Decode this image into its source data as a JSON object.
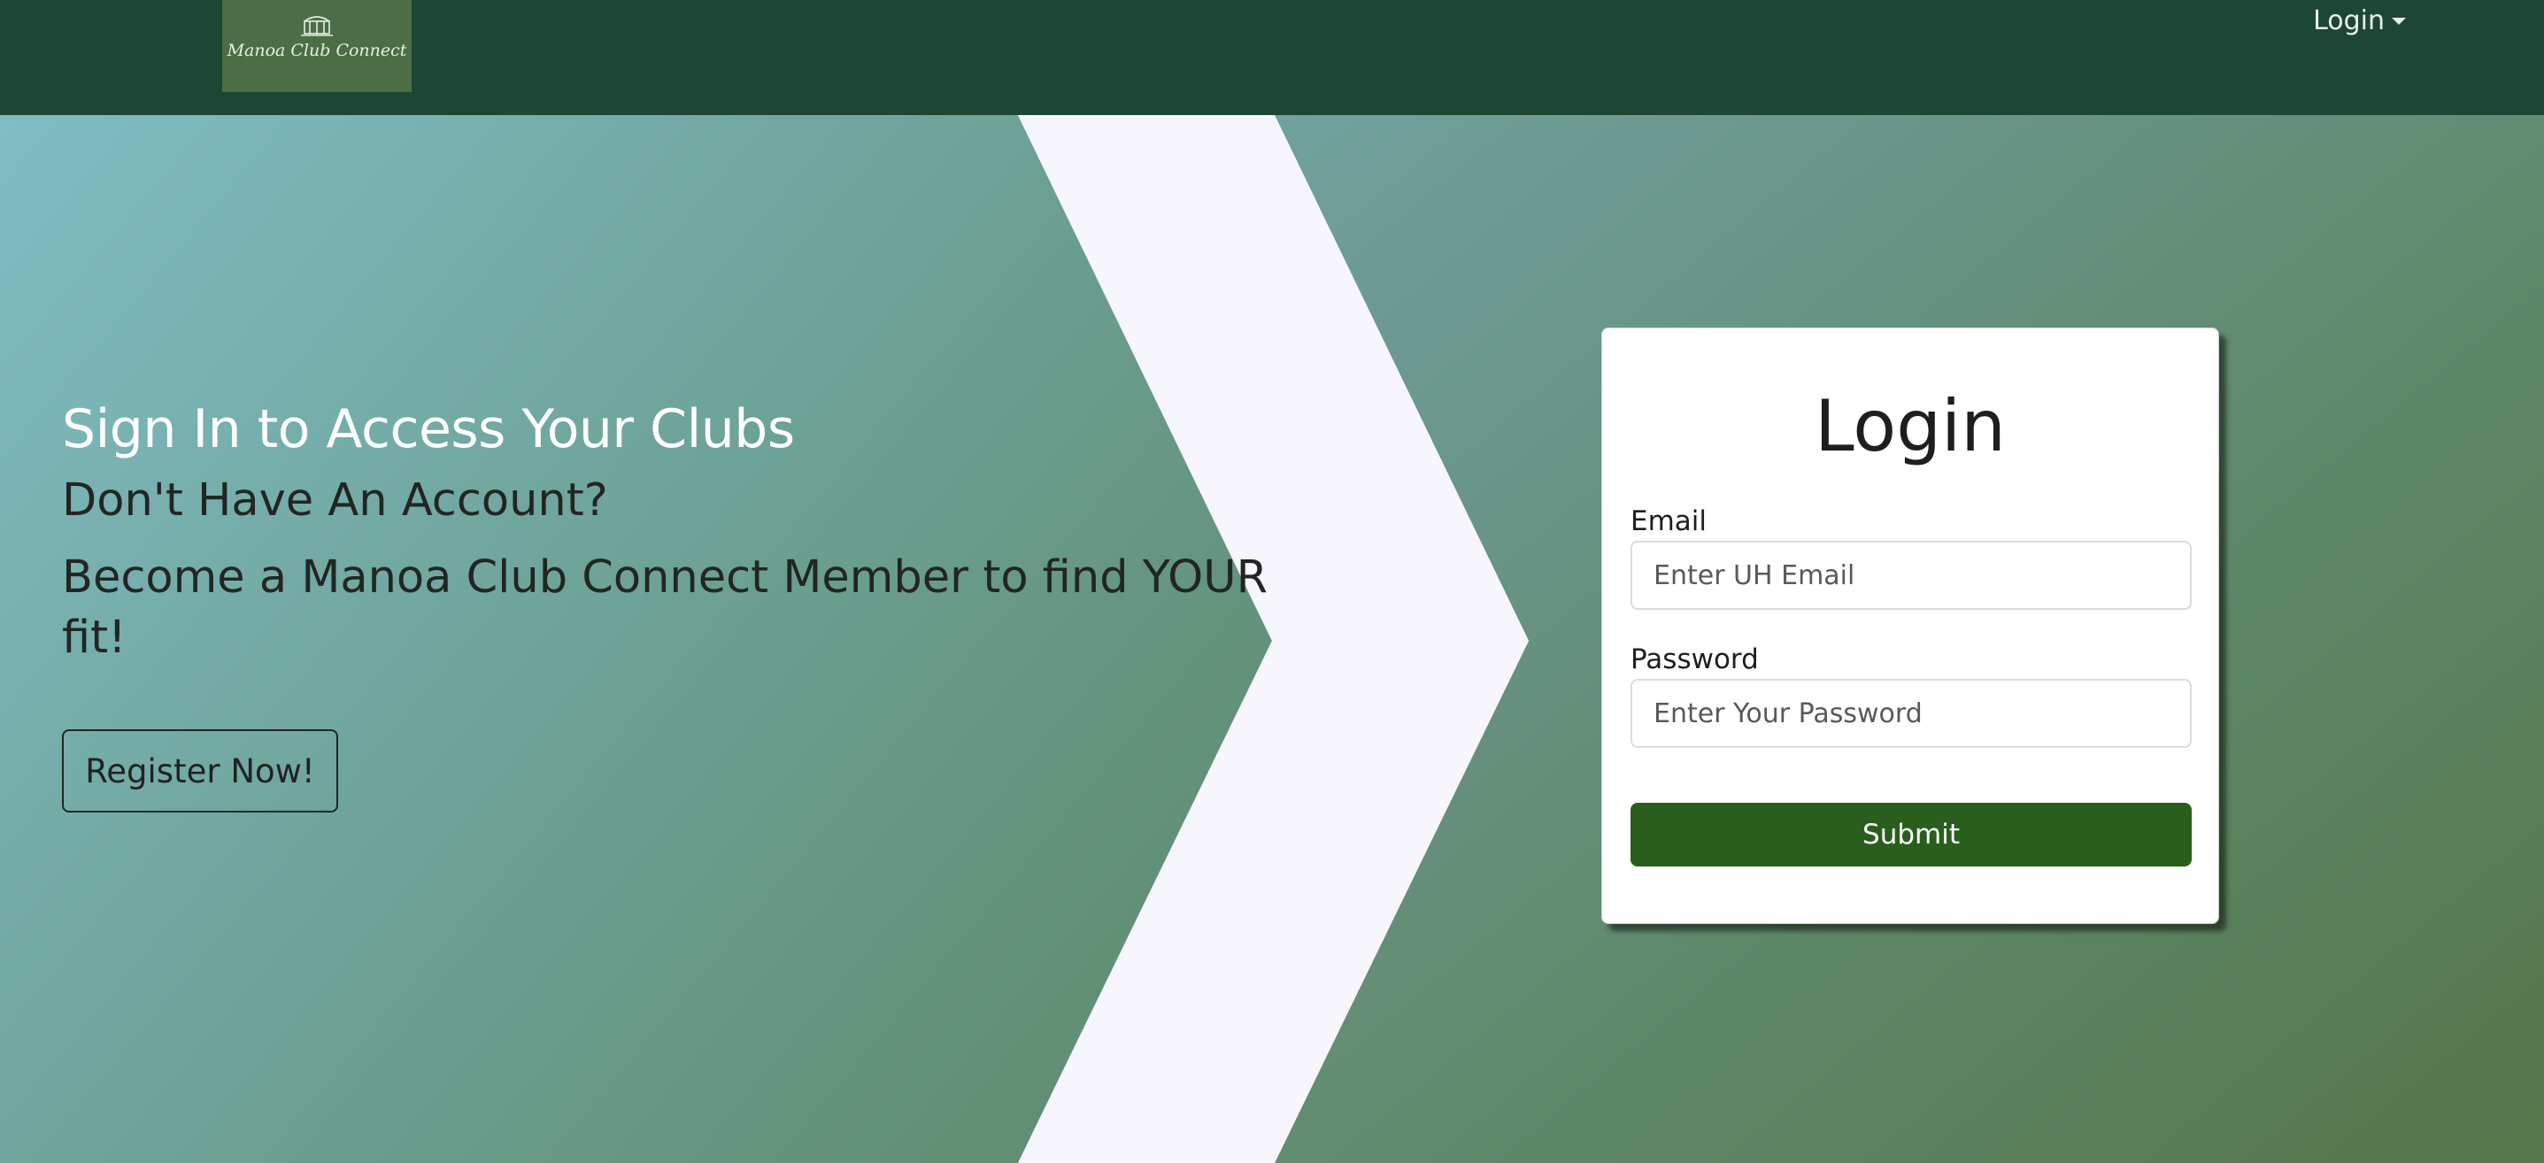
{
  "navbar": {
    "logo_text": "Manoa Club Connect",
    "login_label": "Login",
    "background": "#1e4634"
  },
  "hero": {
    "heading": "Sign In to Access Your Clubs",
    "subheading": "Don't Have An Account?",
    "tagline": "Become a Manoa Club Connect Member to find YOUR fit!",
    "register_label": "Register Now!"
  },
  "login_card": {
    "title": "Login",
    "email_label": "Email",
    "email_placeholder": "Enter UH Email",
    "email_value": "",
    "password_label": "Password",
    "password_placeholder": "Enter Your Password",
    "password_value": "",
    "submit_label": "Submit",
    "submit_color": "#2a5e1c"
  }
}
